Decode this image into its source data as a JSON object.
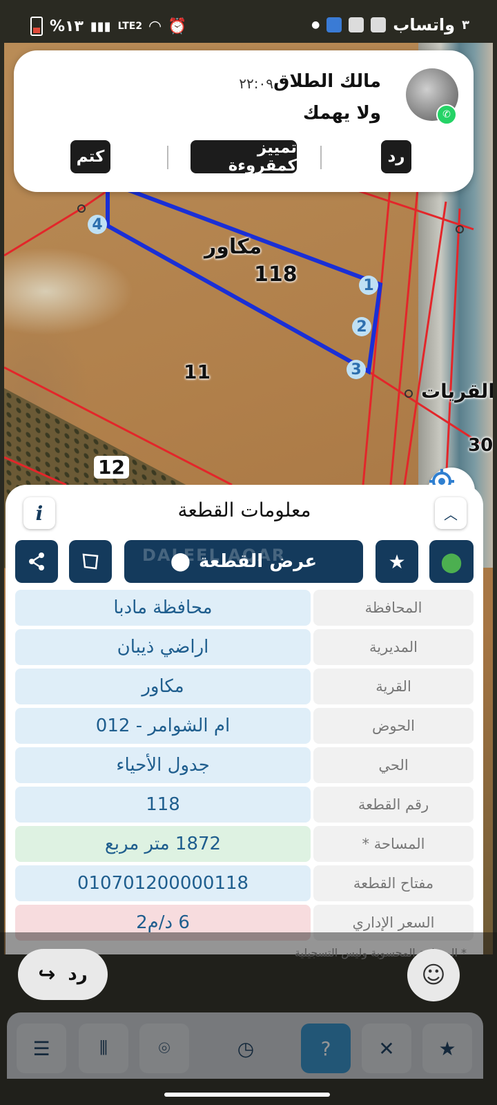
{
  "status_bar": {
    "app_label": "واتساب",
    "notif_count": "٣",
    "battery_percent": "%١٣",
    "network": "LTE2"
  },
  "notification": {
    "sender": "مالك الطلاق",
    "time": "٢٢:٠٩",
    "message": "ولا يهمك",
    "actions": {
      "reply": "رد",
      "mark_read": "تمييز كمقروءة",
      "mute": "كتم"
    },
    "accent_color": "#25d366"
  },
  "map": {
    "parcel_number": "118",
    "village_label": "مكاور",
    "neighbor_parcel_11": "11",
    "neighbor_parcel_12": "12",
    "road_label": "القريات",
    "edge_number": "30",
    "vertices": [
      "1",
      "2",
      "3",
      "4"
    ],
    "boundary_color": "#1a2fd6",
    "lot_line_color": "#e3262a"
  },
  "panel": {
    "title": "معلومات القطعة",
    "view_parcel_label": "عرض القطعة",
    "watermark": "DALEEL AQAR",
    "rows": [
      {
        "label": "المحافظة",
        "value": "محافظة مادبا"
      },
      {
        "label": "المديرية",
        "value": "اراضي ذيبان"
      },
      {
        "label": "القرية",
        "value": "مكاور"
      },
      {
        "label": "الحوض",
        "value": "ام الشوامر - 012"
      },
      {
        "label": "الحي",
        "value": "جدول الأحياء"
      },
      {
        "label": "رقم القطعة",
        "value": "118"
      },
      {
        "label": "المساحة *",
        "value": "1872   متر مربع"
      },
      {
        "label": "مفتاح القطعة",
        "value": "010701200000118"
      },
      {
        "label": "السعر الإداري",
        "value": "6 د/م2"
      }
    ],
    "footnote": "* المساحة المحسوبة وليس التسجيلية",
    "header_color": "#143a5c"
  },
  "reply_overlay": {
    "reply_label": "رد"
  }
}
